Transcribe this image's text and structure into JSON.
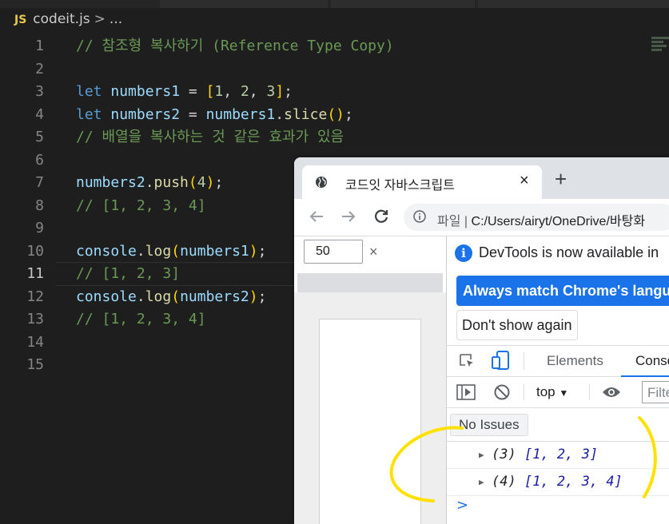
{
  "editor": {
    "tab": {
      "lang_badge": "JS",
      "filename": "codeit.js",
      "sep": ">",
      "crumb_more": "..."
    },
    "line_numbers": [
      "1",
      "2",
      "3",
      "4",
      "5",
      "6",
      "7",
      "8",
      "9",
      "10",
      "11",
      "12",
      "13",
      "14",
      "15"
    ],
    "active_line": "11",
    "code": {
      "l1": "// 참조형 복사하기 (Reference Type Copy)",
      "l3": {
        "kw": "let",
        "var": "numbers1",
        "eq": " = ",
        "open": "[",
        "n1": "1",
        "n2": "2",
        "n3": "3",
        "close": "]",
        "semi": ";"
      },
      "l4": {
        "kw": "let",
        "var": "numbers2",
        "eq": " = ",
        "obj": "numbers1",
        "dot": ".",
        "fn": "slice",
        "call": "()",
        "semi": ";"
      },
      "l5": "// 배열을 복사하는 것 같은 효과가 있음",
      "l7": {
        "obj": "numbers2",
        "dot": ".",
        "fn": "push",
        "open": "(",
        "arg": "4",
        "close": ")",
        "semi": ";"
      },
      "l8": "// [1, 2, 3, 4]",
      "l10": {
        "obj": "console",
        "dot": ".",
        "fn": "log",
        "open": "(",
        "arg": "numbers1",
        "close": ")",
        "semi": ";"
      },
      "l11": "// [1, 2, 3]",
      "l12": {
        "obj": "console",
        "dot": ".",
        "fn": "log",
        "open": "(",
        "arg": "numbers2",
        "close": ")",
        "semi": ";"
      },
      "l13": "// [1, 2, 3, 4]"
    }
  },
  "browser": {
    "tab_title": "코드잇 자바스크립트",
    "tab_close": "×",
    "new_tab": "+",
    "address": {
      "prefix": "파일",
      "divider": "|",
      "url": "C:/Users/airyt/OneDrive/바탕화"
    },
    "viewport": {
      "zoom_value": "50",
      "zoom_close": "×"
    },
    "devtools": {
      "notice": "DevTools is now available in",
      "match_button": "Always match Chrome's language",
      "dismiss_button": "Don't show again",
      "tabs": [
        "Elements",
        "Console"
      ],
      "context": "top",
      "context_arrow": "▼",
      "filter_placeholder": "Filter",
      "issues": "No Issues",
      "logs": [
        {
          "count": "(3)",
          "value": "[1, 2, 3]"
        },
        {
          "count": "(4)",
          "value": "[1, 2, 3, 4]"
        }
      ],
      "prompt": ">"
    }
  },
  "colors": {
    "annotation_yellow": "#ffe100",
    "accent_blue": "#1a73e8"
  }
}
